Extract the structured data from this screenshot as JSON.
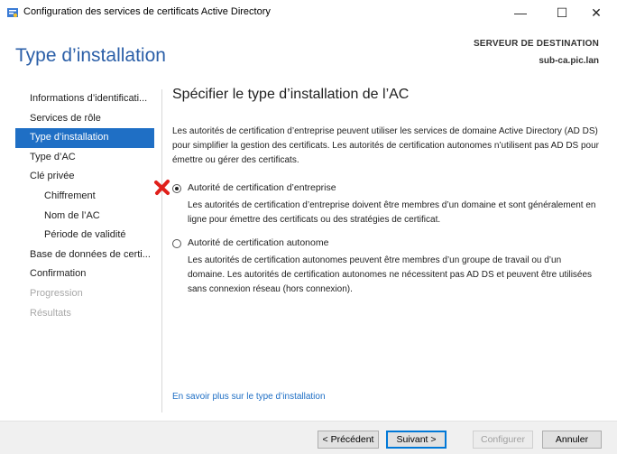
{
  "window": {
    "title": "Configuration des services de certificats Active Directory",
    "minimize_glyph": "—",
    "maximize_glyph": "☐",
    "close_glyph": "✕"
  },
  "header": {
    "page_title": "Type d’installation",
    "destination_label": "SERVEUR DE DESTINATION",
    "destination_server": "sub-ca.pic.lan"
  },
  "sidebar": {
    "items": [
      {
        "label": "Informations d’identificati...",
        "state": "normal",
        "level": 0
      },
      {
        "label": "Services de rôle",
        "state": "normal",
        "level": 0
      },
      {
        "label": "Type d’installation",
        "state": "active",
        "level": 0
      },
      {
        "label": "Type d’AC",
        "state": "normal",
        "level": 0
      },
      {
        "label": "Clé privée",
        "state": "normal",
        "level": 0
      },
      {
        "label": "Chiffrement",
        "state": "normal",
        "level": 1
      },
      {
        "label": "Nom de l’AC",
        "state": "normal",
        "level": 1
      },
      {
        "label": "Période de validité",
        "state": "normal",
        "level": 1
      },
      {
        "label": "Base de données de certi...",
        "state": "normal",
        "level": 0
      },
      {
        "label": "Confirmation",
        "state": "normal",
        "level": 0
      },
      {
        "label": "Progression",
        "state": "disabled",
        "level": 0
      },
      {
        "label": "Résultats",
        "state": "disabled",
        "level": 0
      }
    ]
  },
  "main": {
    "section_title": "Spécifier le type d’installation de l’AC",
    "intro": "Les autorités de certification d’entreprise peuvent utiliser les services de domaine Active Directory (AD DS) pour simplifier la gestion des certificats. Les autorités de certification autonomes n’utilisent pas AD DS pour émettre ou gérer des certificats.",
    "options": [
      {
        "label": "Autorité de certification d’entreprise",
        "description": "Les autorités de certification d’entreprise doivent être membres d’un domaine et sont généralement en ligne pour émettre des certificats ou des stratégies de certificat.",
        "selected": true
      },
      {
        "label": "Autorité de certification autonome",
        "description": "Les autorités de certification autonomes peuvent être membres d’un groupe de travail ou d’un domaine. Les autorités de certification autonomes ne nécessitent pas AD DS et peuvent être utilisées sans connexion réseau (hors connexion).",
        "selected": false
      }
    ],
    "help_link": "En savoir plus sur le type d’installation"
  },
  "footer": {
    "previous_label": "< Précédent",
    "next_label": "Suivant >",
    "configure_label": "Configurer",
    "cancel_label": "Annuler"
  },
  "colors": {
    "accent": "#1f6fc5",
    "title_blue": "#2b5fa8",
    "marker_red": "#e0201b"
  },
  "icons": {
    "app": "certificate-services-icon",
    "marker": "red-x-marker-icon"
  }
}
